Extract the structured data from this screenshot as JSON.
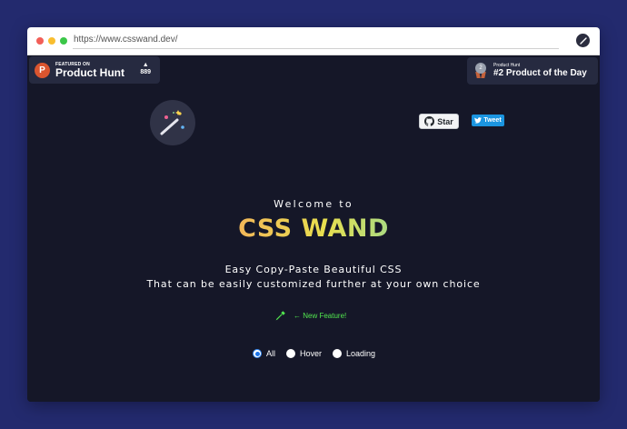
{
  "browser": {
    "url": "https://www.csswand.dev/"
  },
  "product_hunt_featured": {
    "subtitle": "FEATURED ON",
    "title": "Product Hunt",
    "logo_letter": "P",
    "vote_arrow": "▲",
    "votes": "889"
  },
  "product_hunt_award": {
    "medal_number": "2",
    "subtitle": "Product Hunt",
    "title": "#2 Product of the Day"
  },
  "github": {
    "star_label": "Star"
  },
  "twitter": {
    "tweet_label": "Tweet"
  },
  "hero": {
    "welcome": "Welcome to",
    "title": "CSS WAND",
    "tagline_1": "Easy Copy-Paste Beautiful CSS",
    "tagline_2": "That can be easily customized further at your own choice"
  },
  "feature": {
    "label": "← New Feature!"
  },
  "filters": {
    "selected": "All",
    "options": [
      "All",
      "Hover",
      "Loading"
    ]
  },
  "colors": {
    "page_bg": "#232a6e",
    "content_bg": "#151728",
    "accent_green": "#52e84f",
    "radio_blue": "#1a73e8"
  }
}
